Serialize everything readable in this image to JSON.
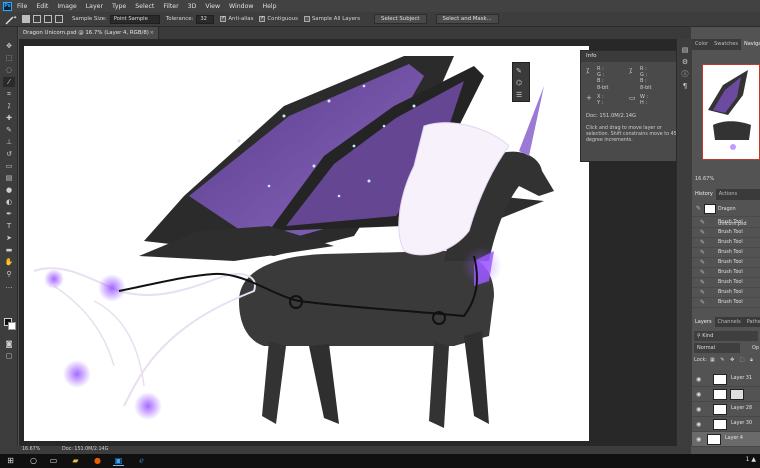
{
  "app": {
    "logo_text": "Ps",
    "accent": "#31a8ff"
  },
  "menu": [
    "File",
    "Edit",
    "Image",
    "Layer",
    "Type",
    "Select",
    "Filter",
    "3D",
    "View",
    "Window",
    "Help"
  ],
  "options": {
    "sample_size_label": "Sample Size:",
    "sample_size_value": "Point Sample",
    "tolerance_label": "Tolerance:",
    "tolerance_value": "32",
    "anti_alias": "Anti-alias",
    "contiguous": "Contiguous",
    "sample_all_layers": "Sample All Layers",
    "select_subject": "Select Subject",
    "select_and_mask": "Select and Mask..."
  },
  "document": {
    "tab_title": "Dragon Unicorn.psd @ 16.7% (Layer 4, RGB/8)",
    "close": "×"
  },
  "info_panel": {
    "title": "Info",
    "r_label": "R :",
    "g_label": "G :",
    "b_label": "B :",
    "bit_left": "8-bit",
    "bit_right": "8-bit",
    "x_label": "X :",
    "y_label": "Y :",
    "w_label": "W :",
    "h_label": "H :",
    "doc": "Doc: 151.0M/2.14G",
    "hint": "Click and drag to move layer or selection. Shift constrains move to 45 degree increments."
  },
  "panels": {
    "top_tabs": [
      "Color",
      "Swatches",
      "Navigator"
    ],
    "nav_zoom": "16.67%",
    "history_tabs": [
      "History",
      "Actions"
    ],
    "history_snapshot": "Dragon Unicorn.psd",
    "history_items": [
      "Brush Tool",
      "Brush Tool",
      "Brush Tool",
      "Brush Tool",
      "Brush Tool",
      "Brush Tool",
      "Brush Tool",
      "Brush Tool",
      "Brush Tool"
    ],
    "layers_tabs": [
      "Layers",
      "Channels",
      "Paths"
    ],
    "kind_filter": "Kind",
    "blend_mode": "Normal",
    "opacity_label": "Op",
    "lock_label": "Lock:",
    "layers": [
      "Layer 31",
      "",
      "Layer 28",
      "Layer 30",
      "Layer 4"
    ]
  },
  "status": {
    "zoom": "16.67%",
    "doc": "Doc: 151.0M/2.14G"
  },
  "taskbar": {
    "tray": "1 ▲"
  }
}
